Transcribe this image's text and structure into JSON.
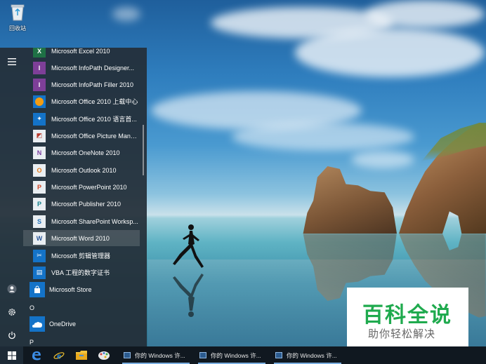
{
  "desktop": {
    "recycle_bin_label": "回收站"
  },
  "start_menu": {
    "rail": [
      "hamburger-menu-icon",
      "user-icon",
      "settings-icon",
      "power-icon"
    ],
    "office_apps": [
      {
        "label": "Microsoft Excel 2010",
        "icon": "excel-icon",
        "color": "#1e7145"
      },
      {
        "label": "Microsoft InfoPath Designer...",
        "icon": "infopath-icon",
        "color": "#7e3f98"
      },
      {
        "label": "Microsoft InfoPath Filler 2010",
        "icon": "infopath-icon",
        "color": "#7e3f98"
      },
      {
        "label": "Microsoft Office 2010 上载中心",
        "icon": "upload-center-icon",
        "color": "#f39c12"
      },
      {
        "label": "Microsoft Office 2010 语言首...",
        "icon": "language-icon",
        "color": "#1473c8"
      },
      {
        "label": "Microsoft Office Picture Mana...",
        "icon": "picture-manager-icon",
        "color": "#b8392c"
      },
      {
        "label": "Microsoft OneNote 2010",
        "icon": "onenote-icon",
        "color": "#7b3fa1"
      },
      {
        "label": "Microsoft Outlook 2010",
        "icon": "outlook-icon",
        "color": "#e47a1a"
      },
      {
        "label": "Microsoft PowerPoint 2010",
        "icon": "powerpoint-icon",
        "color": "#d24726"
      },
      {
        "label": "Microsoft Publisher 2010",
        "icon": "publisher-icon",
        "color": "#127f8b"
      },
      {
        "label": "Microsoft SharePoint Worksp...",
        "icon": "sharepoint-icon",
        "color": "#1e70b8"
      },
      {
        "label": "Microsoft Word 2010",
        "icon": "word-icon",
        "color": "#2b579a"
      },
      {
        "label": "Microsoft 剪辑管理器",
        "icon": "clip-organizer-icon",
        "color": "#7a3fa0"
      },
      {
        "label": "VBA 工程的数字证书",
        "icon": "certificate-icon",
        "color": "#c0392b"
      }
    ],
    "store": {
      "label": "Microsoft Store"
    },
    "letter_o": "O",
    "onedrive": {
      "label": "OneDrive"
    },
    "letter_p": "P"
  },
  "taskbar": {
    "pinned": [
      "start-icon",
      "edge-icon",
      "ie-icon",
      "file-explorer-icon",
      "paint-icon"
    ],
    "windows": [
      {
        "label": "你的 Windows 许..."
      },
      {
        "label": "你的 Windows 许..."
      },
      {
        "label": "你的 Windows 许..."
      }
    ]
  },
  "watermark": {
    "title": "百科全说",
    "subtitle": "助你轻松解决"
  }
}
